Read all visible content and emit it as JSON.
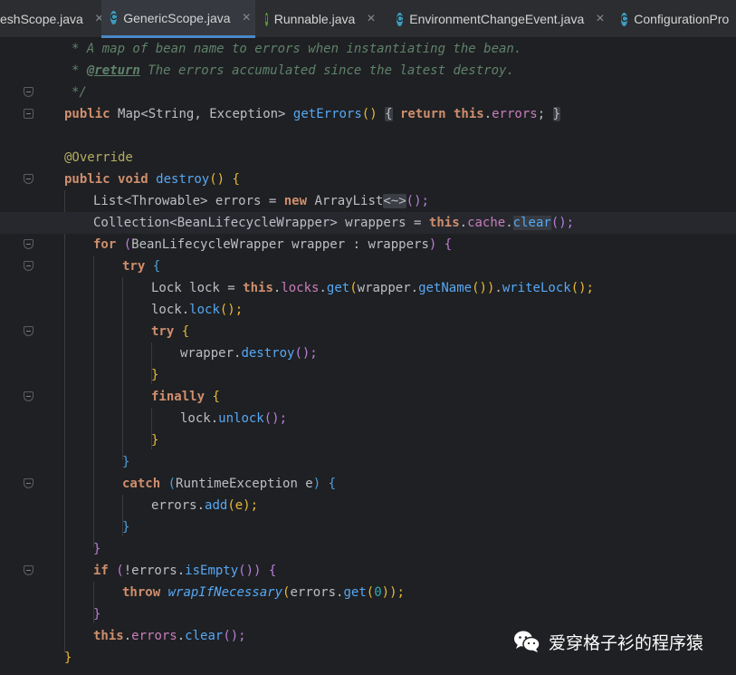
{
  "tabs": [
    {
      "label": "eshScope.java",
      "icon": "class-icon",
      "active": false
    },
    {
      "label": "GenericScope.java",
      "icon": "class-icon",
      "active": true
    },
    {
      "label": "Runnable.java",
      "icon": "interface-icon",
      "active": false
    },
    {
      "label": "EnvironmentChangeEvent.java",
      "icon": "class-icon",
      "active": false
    },
    {
      "label": "ConfigurationPro",
      "icon": "class-icon",
      "active": false
    }
  ],
  "tab_icon_letters": {
    "class": "C",
    "interface": "I"
  },
  "close_glyph": "×",
  "code": {
    "l0": "* A map of bean name to errors when instantiating the bean.",
    "l1_tag": "@return",
    "l1_text": " The errors accumulated since the latest destroy.",
    "l2": "*/",
    "l3": {
      "kw": "public",
      "type": "Map",
      "lt": "<",
      "g1": "String",
      "comma": ", ",
      "g2": "Exception",
      "gt": ">",
      "method": "getErrors",
      "paren": "()",
      "brace_open": "{",
      "ret": "return",
      "this": "this",
      "dot": ".",
      "field": "errors",
      "semi": ";",
      "brace_close": "}"
    },
    "l5": "@Override",
    "l6": {
      "kw1": "public",
      "kw2": "void",
      "method": "destroy",
      "rest": "() {"
    },
    "l7": {
      "type": "List",
      "lt": "<",
      "g": "Throwable",
      "gt": ">",
      "var": " errors = ",
      "new": "new",
      "cls": "ArrayList",
      "diamond": "<~>",
      "end": "();"
    },
    "l8": {
      "type": "Collection",
      "lt": "<",
      "g": "BeanLifecycleWrapper",
      "gt": ">",
      "var": " wrappers = ",
      "this": "this",
      "dot1": ".",
      "field": "cache",
      "dot2": ".",
      "method": "clear",
      "end": "();"
    },
    "l9": {
      "kw": "for",
      "open": " (",
      "type": "BeanLifecycleWrapper",
      "rest": " wrapper : wrappers",
      "close": ")",
      "brace": " {"
    },
    "l10": {
      "kw": "try",
      "brace": " {"
    },
    "l11": {
      "type": "Lock",
      "var": " lock = ",
      "this": "this",
      "dot1": ".",
      "field": "locks",
      "dot2": ".",
      "m1": "get",
      "p1": "(",
      "arg": "wrapper.",
      "m2": "getName",
      "p2": "())",
      "dot3": ".",
      "m3": "writeLock",
      "end": "();"
    },
    "l12": {
      "obj": "lock.",
      "method": "lock",
      "end": "();"
    },
    "l13": {
      "kw": "try",
      "brace": " {"
    },
    "l14": {
      "obj": "wrapper.",
      "method": "destroy",
      "end": "();"
    },
    "l15": "}",
    "l16": {
      "kw": "finally",
      "brace": " {"
    },
    "l17": {
      "obj": "lock.",
      "method": "unlock",
      "end": "();"
    },
    "l18": "}",
    "l19": "}",
    "l20": {
      "kw": "catch",
      "open": " (",
      "type": "RuntimeException",
      "rest": " e",
      "close": ")",
      "brace": " {"
    },
    "l21": {
      "obj": "errors.",
      "method": "add",
      "end": "(e);"
    },
    "l22": "}",
    "l23": "}",
    "l24": {
      "kw": "if",
      "open": " (",
      "rest": "!errors.",
      "method": "isEmpty",
      "close": "())",
      "brace": " {"
    },
    "l25": {
      "kw": "throw",
      "method": "wrapIfNecessary",
      "p1": "(",
      "obj": "errors.",
      "m2": "get",
      "p2": "(",
      "num": "0",
      "end": "));"
    },
    "l26": "}",
    "l27": {
      "this": "this",
      "dot1": ".",
      "field": "errors",
      "dot2": ".",
      "method": "clear",
      "end": "();"
    },
    "l28": "}"
  },
  "watermark": {
    "text": "爱穿格子衫的程序猿",
    "icon": "wechat-icon"
  },
  "colors": {
    "keyword": "#cf8e6d",
    "method": "#56a8f5",
    "field": "#c77dbb",
    "comment": "#5f826b",
    "annotation": "#b3ae60",
    "number": "#2aacb8",
    "tab_active_underline": "#4a88c7"
  }
}
